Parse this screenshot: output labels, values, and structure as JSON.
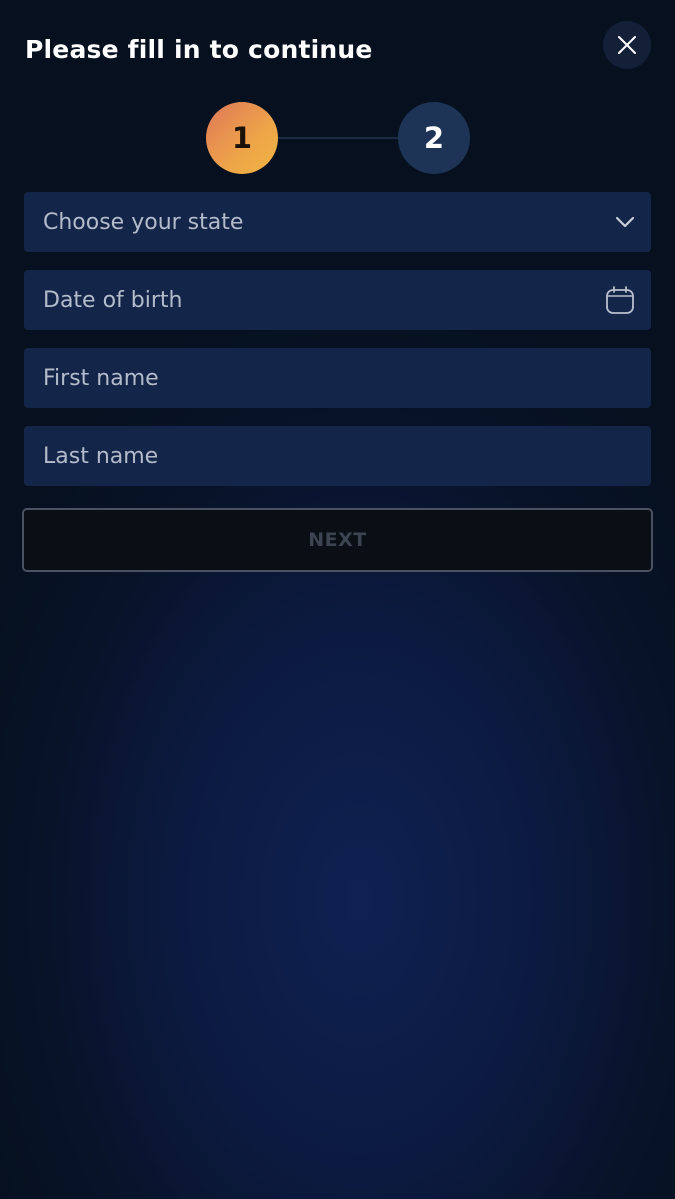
{
  "header": {
    "title": "Please fill in to continue",
    "close_icon": "close-icon"
  },
  "stepper": {
    "steps": [
      {
        "label": "1",
        "state": "active"
      },
      {
        "label": "2",
        "state": "inactive"
      }
    ]
  },
  "form": {
    "state_select": {
      "placeholder": "Choose your state",
      "icon": "chevron-down-icon"
    },
    "date_of_birth": {
      "placeholder": "Date of birth",
      "icon": "calendar-icon"
    },
    "first_name": {
      "placeholder": "First name"
    },
    "last_name": {
      "placeholder": "Last name"
    },
    "next_label": "NEXT"
  },
  "colors": {
    "background": "#0c1a40",
    "field_background": "#14254a",
    "step_active_start": "#e0765a",
    "step_active_end": "#f0b545",
    "step_inactive": "#1d3456",
    "button_disabled_text": "#3b4450"
  }
}
